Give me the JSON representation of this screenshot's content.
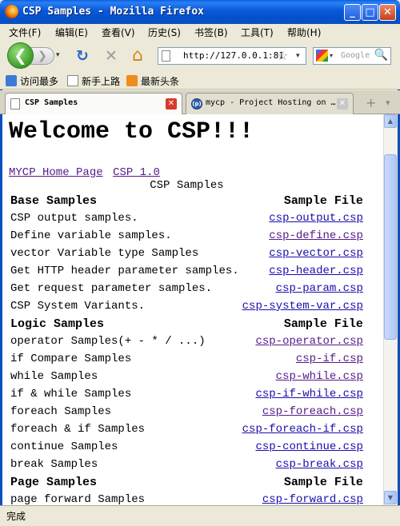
{
  "window": {
    "title": "CSP Samples - Mozilla Firefox",
    "minimize": "_",
    "maximize": "□",
    "close": "✕"
  },
  "menu": [
    "文件(F)",
    "编辑(E)",
    "查看(V)",
    "历史(S)",
    "书签(B)",
    "工具(T)",
    "帮助(H)"
  ],
  "nav": {
    "back": "❮",
    "forward": "❯",
    "dropdown": "▾",
    "reload": "↻",
    "stop": "✕",
    "home": "⌂",
    "url": "http://127.0.0.1:81",
    "bookmark_star": "☆",
    "search_placeholder": "Google",
    "search_icon": "🔍"
  },
  "bookmarks": [
    "访问最多",
    "新手上路",
    "最新头条"
  ],
  "tabs": [
    {
      "label": "CSP Samples",
      "active": true,
      "close": "✕"
    },
    {
      "label": "mycp - Project Hosting on …",
      "active": false,
      "close": "✕"
    }
  ],
  "tab_buttons": {
    "new_tab": "+",
    "list_tabs": "▾"
  },
  "content": {
    "heading": "Welcome to CSP!!!",
    "links": [
      "MYCP Home Page",
      "CSP 1.0"
    ],
    "table_caption": "CSP Samples",
    "sections": [
      {
        "title": "Base Samples",
        "file_header": "Sample File",
        "rows": [
          {
            "desc": "CSP output samples.",
            "file": "csp-output.csp",
            "visited": false
          },
          {
            "desc": "Define variable samples.",
            "file": "csp-define.csp",
            "visited": true
          },
          {
            "desc": "vector Variable type Samples",
            "file": "csp-vector.csp",
            "visited": false
          },
          {
            "desc": "Get HTTP header parameter samples.",
            "file": "csp-header.csp",
            "visited": false
          },
          {
            "desc": "Get request parameter samples.",
            "file": "csp-param.csp",
            "visited": false
          },
          {
            "desc": "CSP System Variants.",
            "file": "csp-system-var.csp",
            "visited": false
          }
        ]
      },
      {
        "title": "Logic Samples",
        "file_header": "Sample File",
        "rows": [
          {
            "desc": "operator Samples(+ - * / ...)",
            "file": "csp-operator.csp",
            "visited": true
          },
          {
            "desc": "if Compare Samples",
            "file": "csp-if.csp",
            "visited": true
          },
          {
            "desc": "while Samples",
            "file": "csp-while.csp",
            "visited": true
          },
          {
            "desc": "if & while Samples",
            "file": "csp-if-while.csp",
            "visited": false
          },
          {
            "desc": "foreach Samples",
            "file": "csp-foreach.csp",
            "visited": true
          },
          {
            "desc": "foreach & if Samples",
            "file": "csp-foreach-if.csp",
            "visited": false
          },
          {
            "desc": "continue Samples",
            "file": "csp-continue.csp",
            "visited": false
          },
          {
            "desc": "break Samples",
            "file": "csp-break.csp",
            "visited": false
          }
        ]
      },
      {
        "title": "Page Samples",
        "file_header": "Sample File",
        "rows": [
          {
            "desc": "page forward Samples",
            "file": "csp-forward.csp",
            "visited": false
          }
        ]
      }
    ]
  },
  "scrollbar": {
    "up": "▲",
    "down": "▼"
  },
  "status": "完成"
}
